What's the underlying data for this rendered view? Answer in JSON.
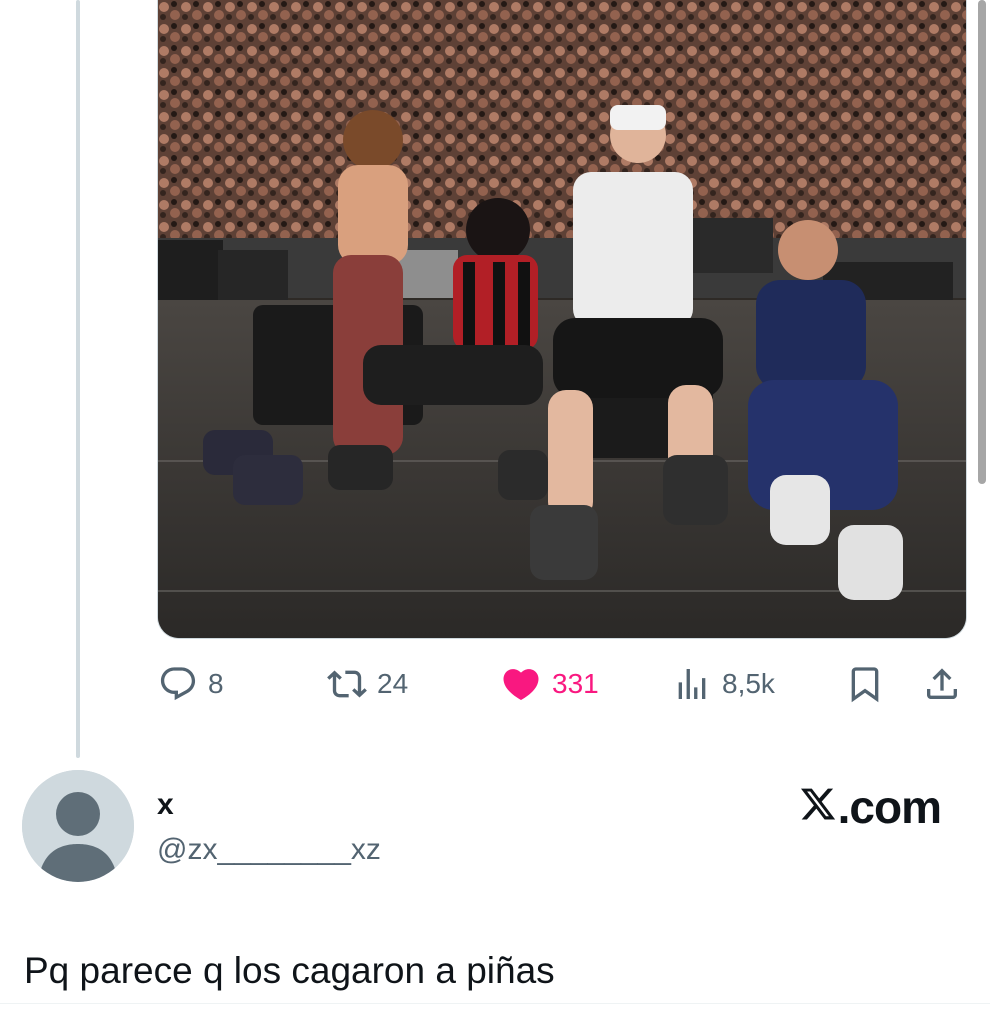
{
  "tweet": {
    "image_alt": "",
    "stats": {
      "replies": "8",
      "retweets": "24",
      "likes": "331",
      "views": "8,5k"
    },
    "icons": {
      "reply": "reply-icon",
      "retweet": "retweet-icon",
      "like": "heart-icon",
      "views": "views-chart-icon",
      "bookmark": "bookmark-icon",
      "share": "share-icon"
    },
    "like_color": "#f91880"
  },
  "reply": {
    "display_name": "x",
    "handle": "@zx________xz",
    "brand": ".com",
    "text": "Pq parece q los cagaron a piñas"
  },
  "colors": {
    "accent_like": "#f91880",
    "muted": "#536471",
    "text": "#0f1419",
    "avatar_bg": "#cfd9de"
  }
}
